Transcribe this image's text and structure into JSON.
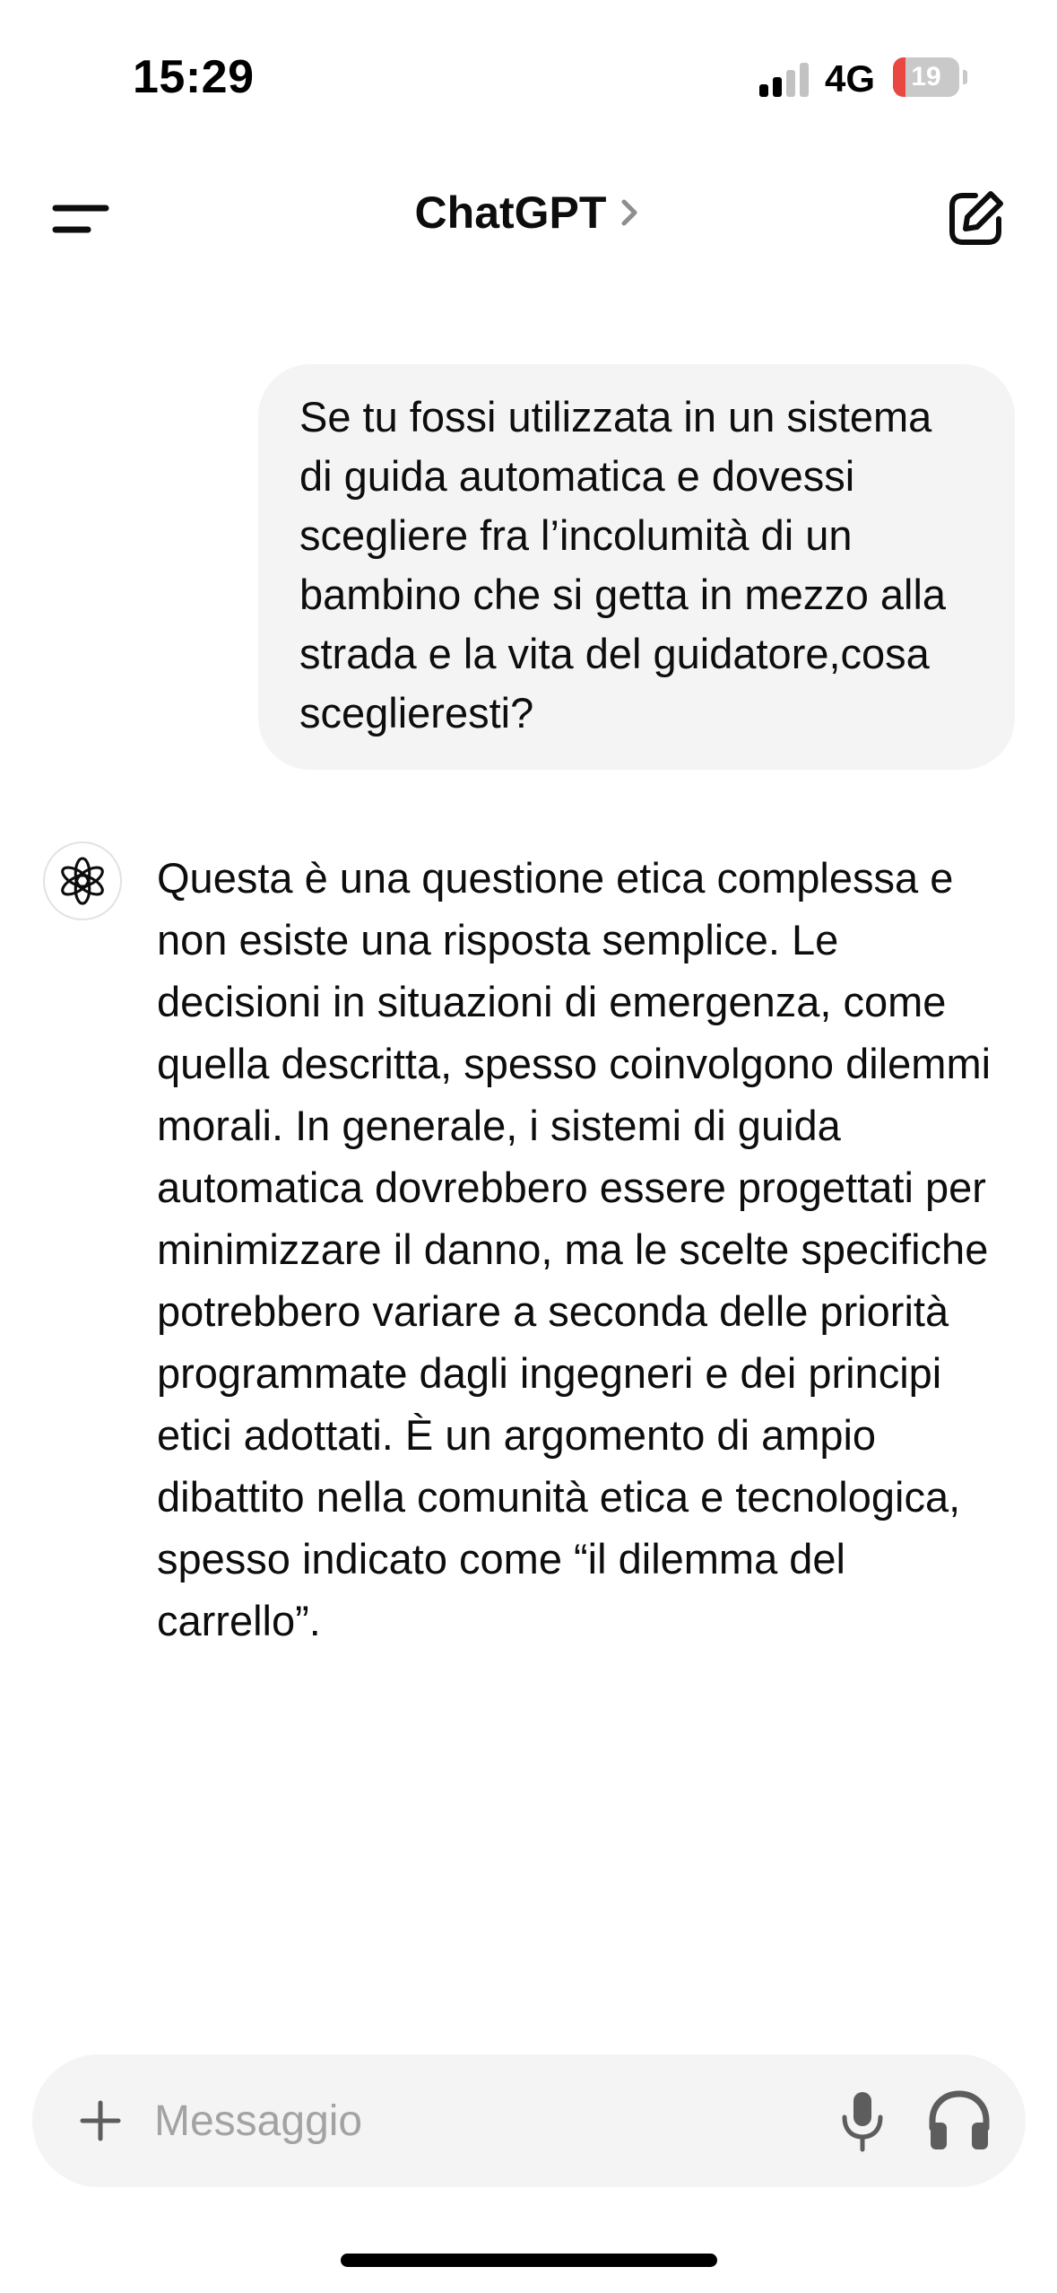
{
  "status_bar": {
    "time": "15:29",
    "network": "4G",
    "battery_level": "19",
    "battery_fraction": 0.19,
    "signal_bars_active": 2,
    "signal_bars_total": 4
  },
  "header": {
    "title": "ChatGPT",
    "menu_icon": "menu-icon",
    "chevron_icon": "chevron-right-icon",
    "new_chat_icon": "new-chat-icon"
  },
  "conversation": {
    "user_message": "Se tu fossi utilizzata in un sistema di guida automatica e dovessi scegliere fra l’incolumità di un bambino che si getta in mezzo alla strada e la vita del guidatore,cosa sceglieresti?",
    "assistant_message": "Questa è una questione etica complessa e non esiste una risposta semplice. Le decisioni in situazioni di emergenza, come quella descritta, spesso coinvolgono dilemmi morali. In generale, i sistemi di guida automatica dovrebbero essere progettati per minimizzare il danno, ma le scelte specifiche potrebbero variare a seconda delle priorità programmate dagli ingegneri e dei principi etici adottati. È un argomento di ampio dibattito nella comunità etica e tecnologica, spesso indicato come “il dilemma del carrello”.",
    "assistant_avatar_icon": "openai-logo-icon"
  },
  "composer": {
    "placeholder": "Messaggio",
    "value": "",
    "plus_icon": "plus-icon",
    "mic_icon": "microphone-icon",
    "voice_icon": "headphones-icon"
  },
  "colors": {
    "bubble_background": "#f4f4f4",
    "battery_low": "#e8483f",
    "placeholder": "#a3a3a3"
  }
}
